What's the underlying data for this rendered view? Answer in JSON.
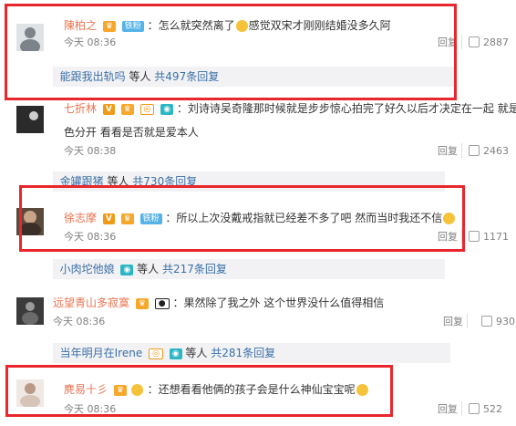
{
  "comments": [
    {
      "name": "陳柏之",
      "badge": "铁粉",
      "text_a": "：怎么就突然离了",
      "text_b": "感觉双宋才刚刚结婚没多久阿",
      "time": "今天 08:36",
      "reply": "回复",
      "likes": "2887",
      "sub_link": "能跟我出轨吗",
      "sub_text": " 等人 ",
      "sub_count": "共497条回复"
    },
    {
      "name": "七折林",
      "text_line1": "：刘诗诗吴奇隆那时候就是步步惊心拍完了好久以后才决定在一起 就是为了和角",
      "text_line2": "色分开 看看是否就是爱本人",
      "time": "今天 08:38",
      "reply": "回复",
      "likes": "2463",
      "sub_link": "金罐跟猪",
      "sub_text": " 等人 ",
      "sub_count": "共730条回复"
    },
    {
      "name": "徐志摩",
      "badge": "铁粉",
      "text": "：所以上次没戴戒指就已经差不多了吧 然而当时我还不信",
      "time": "今天 08:36",
      "reply": "回复",
      "likes": "1171",
      "sub_link": "小肉坨他娘",
      "sub_text": " 等人 ",
      "sub_count": "共217条回复"
    },
    {
      "name": "远望青山多寂寞",
      "text": "：果然除了我之外 这个世界没什么值得相信",
      "time": "今天 08:36",
      "reply": "回复",
      "likes": "930",
      "sub_link": "当年明月在Irene",
      "sub_text": " 等人 ",
      "sub_count": "共281条回复"
    },
    {
      "name": "麂易十彡",
      "text": "：还想看看他俩的孩子会是什么神仙宝宝呢",
      "time": "今天 08:36",
      "reply": "回复",
      "likes": "522"
    }
  ],
  "colors": {
    "name": "#eb7350",
    "link": "#3a6fa6",
    "highlight_box": "#e8262b",
    "subbar_bg": "#f2f2f5"
  },
  "icons": {
    "vip": "crown-vip-icon",
    "verified": "v-verified-icon",
    "like": "thumbs-up-icon",
    "emoji": "cry-emoji-icon"
  }
}
